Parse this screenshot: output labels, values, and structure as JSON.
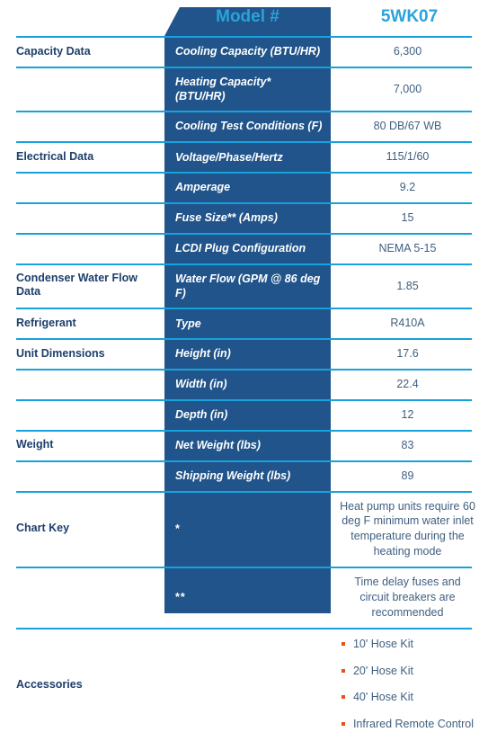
{
  "colors": {
    "dark_blue": "#21548a",
    "rule_blue": "#17a2dc",
    "header_text": "#29a3db",
    "label_navy": "#1d3f6b",
    "value_slate": "#3f5f80",
    "bullet_orange": "#e2521f"
  },
  "header": {
    "spec_column": "Model #",
    "model_number": "5WK07"
  },
  "rows": [
    {
      "group": "Capacity Data",
      "spec": "Cooling Capacity (BTU/HR)",
      "value": "6,300"
    },
    {
      "group": "",
      "spec": "Heating Capacity* (BTU/HR)",
      "value": "7,000"
    },
    {
      "group": "",
      "spec": "Cooling Test Conditions (F)",
      "value": "80 DB/67 WB"
    },
    {
      "group": "Electrical Data",
      "spec": "Voltage/Phase/Hertz",
      "value": "115/1/60"
    },
    {
      "group": "",
      "spec": "Amperage",
      "value": "9.2"
    },
    {
      "group": "",
      "spec": "Fuse Size** (Amps)",
      "value": "15"
    },
    {
      "group": "",
      "spec": "LCDI Plug Configuration",
      "value": "NEMA 5-15"
    },
    {
      "group": "Condenser Water Flow Data",
      "spec": "Water Flow (GPM @ 86 deg F)",
      "value": "1.85"
    },
    {
      "group": "Refrigerant",
      "spec": "Type",
      "value": "R410A"
    },
    {
      "group": "Unit Dimensions",
      "spec": "Height (in)",
      "value": "17.6"
    },
    {
      "group": "",
      "spec": "Width (in)",
      "value": "22.4"
    },
    {
      "group": "",
      "spec": "Depth (in)",
      "value": "12"
    },
    {
      "group": "Weight",
      "spec": "Net Weight (lbs)",
      "value": "83"
    },
    {
      "group": "",
      "spec": "Shipping Weight (lbs)",
      "value": "89"
    }
  ],
  "chart_key": {
    "group": "Chart Key",
    "entries": [
      {
        "symbol": "*",
        "note": "Heat pump units require 60 deg F minimum water inlet temperature during the heating mode"
      },
      {
        "symbol": "**",
        "note": "Time delay fuses and circuit breakers are recommended"
      }
    ]
  },
  "accessories": {
    "group": "Accessories",
    "spec": "",
    "items": [
      "10' Hose Kit",
      "20' Hose Kit",
      "40' Hose Kit",
      "Infrared Remote Control"
    ]
  }
}
